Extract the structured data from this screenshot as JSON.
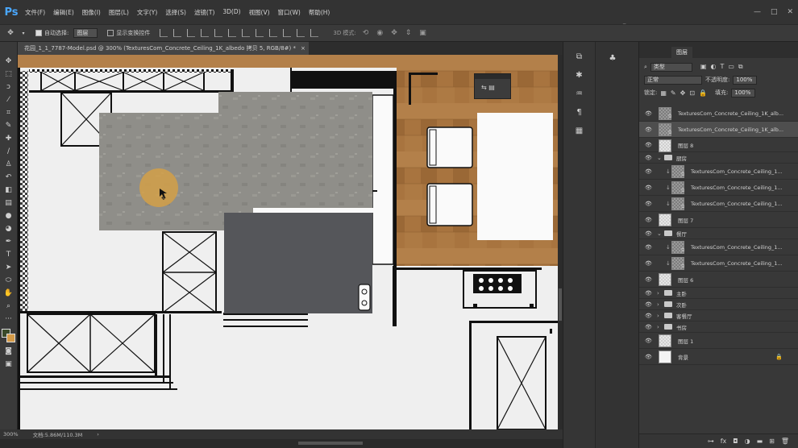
{
  "app": {
    "logo": "Ps"
  },
  "menu": [
    "文件(F)",
    "编辑(E)",
    "图像(I)",
    "图层(L)",
    "文字(Y)",
    "选择(S)",
    "滤镜(T)",
    "3D(D)",
    "视图(V)",
    "窗口(W)",
    "帮助(H)"
  ],
  "options_bar": {
    "auto_select_label": "自动选择:",
    "auto_select_value": "图层",
    "show_transform_label": "显示变换控件",
    "mode_3d_label": "3D 模式:"
  },
  "document": {
    "tab_title": "花园_1_1_7787-Model.psd @ 300% (TexturesCom_Concrete_Ceiling_1K_albedo 拷贝 5, RGB/8#) *",
    "close_glyph": "×"
  },
  "status": {
    "zoom": "300%",
    "doc_size": "文档:5.86M/110.3M"
  },
  "watermark": "虎课网",
  "layers_panel": {
    "tabs": [
      "图层"
    ],
    "filter_kind": "类型",
    "blend_mode": "正常",
    "opacity_label": "不透明度:",
    "opacity_value": "100%",
    "lock_label": "锁定:",
    "fill_label": "填充:",
    "fill_value": "100%",
    "layers": [
      {
        "name": "TexturesCom_Concrete_Ceiling_1K_alb...",
        "thumb": "texture",
        "selected": false
      },
      {
        "name": "TexturesCom_Concrete_Ceiling_1K_alb...",
        "thumb": "texture",
        "selected": true
      },
      {
        "name": "图层 8",
        "thumb": "blank",
        "selected": false
      },
      {
        "name": "厨房",
        "group": true,
        "expanded": true
      },
      {
        "name": "TexturesCom_Concrete_Ceiling_1...",
        "thumb": "texture",
        "clipped": true
      },
      {
        "name": "TexturesCom_Concrete_Ceiling_1...",
        "thumb": "texture",
        "clipped": true
      },
      {
        "name": "TexturesCom_Concrete_Ceiling_1...",
        "thumb": "texture",
        "clipped": true
      },
      {
        "name": "图层 7",
        "thumb": "blank"
      },
      {
        "name": "餐厅",
        "group": true,
        "expanded": true
      },
      {
        "name": "TexturesCom_Concrete_Ceiling_1...",
        "thumb": "texture",
        "clipped": true
      },
      {
        "name": "TexturesCom_Concrete_Ceiling_1...",
        "thumb": "texture",
        "clipped": true
      },
      {
        "name": "图层 6",
        "thumb": "blank"
      },
      {
        "name": "主卧",
        "group": true,
        "expanded": false
      },
      {
        "name": "次卧",
        "group": true,
        "expanded": false
      },
      {
        "name": "客餐厅",
        "group": true,
        "expanded": false
      },
      {
        "name": "书房",
        "group": true,
        "expanded": false
      },
      {
        "name": "图层 1",
        "thumb": "blank"
      },
      {
        "name": "背景",
        "thumb": "white",
        "locked": true
      }
    ]
  },
  "colors": {
    "accent": "#4aa8ff",
    "foreground": "#3a4a2a",
    "background_swatch": "#d49a48",
    "wood": "#a8743f",
    "concrete": "#8f8e89"
  }
}
